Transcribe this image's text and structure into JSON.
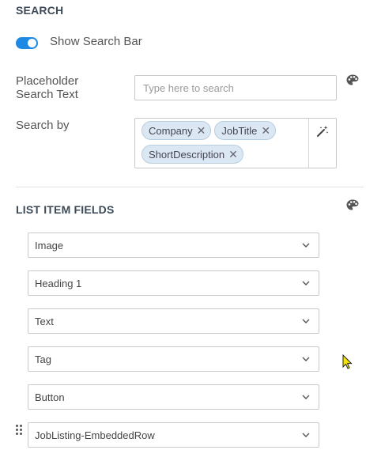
{
  "search_section": {
    "title": "SEARCH",
    "toggle_label": "Show Search Bar",
    "toggle_on": true,
    "placeholder_label_line1": "Placeholder",
    "placeholder_label_line2": "Search Text",
    "placeholder_value": "Type here to search",
    "search_by_label": "Search by",
    "search_by_tags": [
      "Company",
      "JobTitle",
      "ShortDescription"
    ]
  },
  "list_item_fields": {
    "title": "LIST ITEM FIELDS",
    "fields": [
      "Image",
      "Heading 1",
      "Text",
      "Tag",
      "Button",
      "JobListing-EmbeddedRow"
    ]
  },
  "icons": {
    "palette": "palette-icon",
    "magic_wand": "magic-wand-icon",
    "chevron": "chevron-down-icon",
    "drag": "drag-handle-icon",
    "remove": "close-icon",
    "cursor": "mouse-pointer-icon"
  },
  "colors": {
    "accent": "#1e88e5",
    "tag_bg": "#dbe8f3",
    "heading": "#3c4a57"
  }
}
